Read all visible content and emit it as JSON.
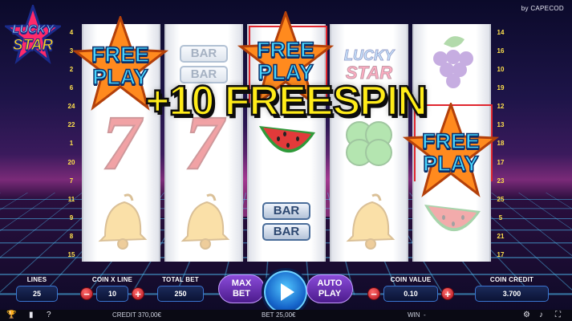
{
  "brand": "by CAPECOD",
  "logo": {
    "line1": "LUCKY",
    "line2": "STAR"
  },
  "line_numbers": {
    "left": [
      "4",
      "3",
      "2",
      "6",
      "24",
      "22",
      "1",
      "20",
      "7",
      "11",
      "9",
      "8",
      "15"
    ],
    "right": [
      "14",
      "16",
      "10",
      "19",
      "12",
      "13",
      "18",
      "17",
      "23",
      "25",
      "5",
      "21",
      "17"
    ]
  },
  "reels": [
    {
      "symbols": [
        "free-play",
        "seven",
        "bell"
      ]
    },
    {
      "symbols": [
        "bar",
        "seven",
        "bell"
      ]
    },
    {
      "symbols": [
        "free-play",
        "watermelon",
        "bar"
      ]
    },
    {
      "symbols": [
        "lucky-star",
        "clover",
        "bell"
      ]
    },
    {
      "symbols": [
        "grapes",
        "free-play",
        "watermelon"
      ]
    }
  ],
  "symbol_text": {
    "bar": "BAR",
    "free": "FREE",
    "play": "PLAY",
    "lucky": "LUCKY",
    "star": "STAR"
  },
  "banner": "+10 FREESPIN",
  "controls": {
    "lines": {
      "label": "LINES",
      "value": "25"
    },
    "coin_x_line": {
      "label": "COIN X LINE",
      "value": "10"
    },
    "total_bet": {
      "label": "TOTAL BET",
      "value": "250"
    },
    "max_bet": {
      "line1": "MAX",
      "line2": "BET"
    },
    "auto_play": {
      "line1": "AUTO",
      "line2": "PLAY"
    },
    "coin_value": {
      "label": "COIN VALUE",
      "value": "0.10"
    },
    "coin_credit": {
      "label": "COIN CREDIT",
      "value": "3.700"
    },
    "minus": "−",
    "plus": "+"
  },
  "status": {
    "credit_label": "CREDIT",
    "credit_value": "370,00€",
    "bet_label": "BET",
    "bet_value": "25,00€",
    "win_label": "WIN",
    "win_value": "-"
  },
  "icons": [
    "trophy-icon",
    "paytable-icon",
    "help-icon",
    "settings-icon",
    "sound-icon",
    "fullscreen-icon"
  ],
  "colors": {
    "banner": "#ffec18",
    "reel_bg": "#ffffff",
    "win_frame": "#e0262f",
    "accent": "#3a74d0"
  }
}
